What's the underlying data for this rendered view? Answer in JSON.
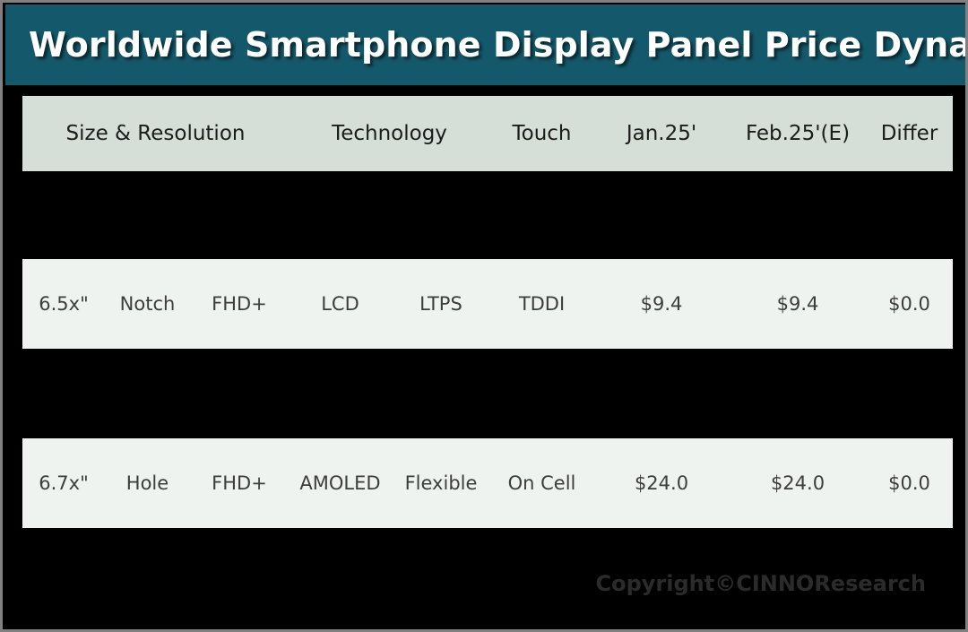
{
  "title": "Worldwide Smartphone Display Panel Price Dynamic",
  "colors": {
    "title_bar": "#14596b",
    "title_text": "#ffffff",
    "header_row_bg": "#d5dfd7",
    "data_row_bg": "#eff3f0",
    "page_bg": "#000000",
    "outer_border": "#808080",
    "body_text": "#3d3d3d",
    "copyright_text": "#2b2b2b"
  },
  "table": {
    "headers": {
      "size_resolution": "Size & Resolution",
      "technology": "Technology",
      "touch": "Touch",
      "jan": "Jan.25'",
      "feb": "Feb.25'(E)",
      "differ": "Differ"
    },
    "rows": [
      {
        "size": "6.5x\"",
        "cutout": "Notch",
        "resolution": "FHD+",
        "technology": "LCD",
        "backplane": "LTPS",
        "touch": "TDDI",
        "jan": "$9.4",
        "feb": "$9.4",
        "differ": "$0.0"
      },
      {
        "size": "6.7x\"",
        "cutout": "Hole",
        "resolution": "FHD+",
        "technology": "AMOLED",
        "backplane": "Flexible",
        "touch": "On Cell",
        "jan": "$24.0",
        "feb": "$24.0",
        "differ": "$0.0"
      }
    ]
  },
  "footer": {
    "copyright": "Copyright©CINNOResearch"
  }
}
